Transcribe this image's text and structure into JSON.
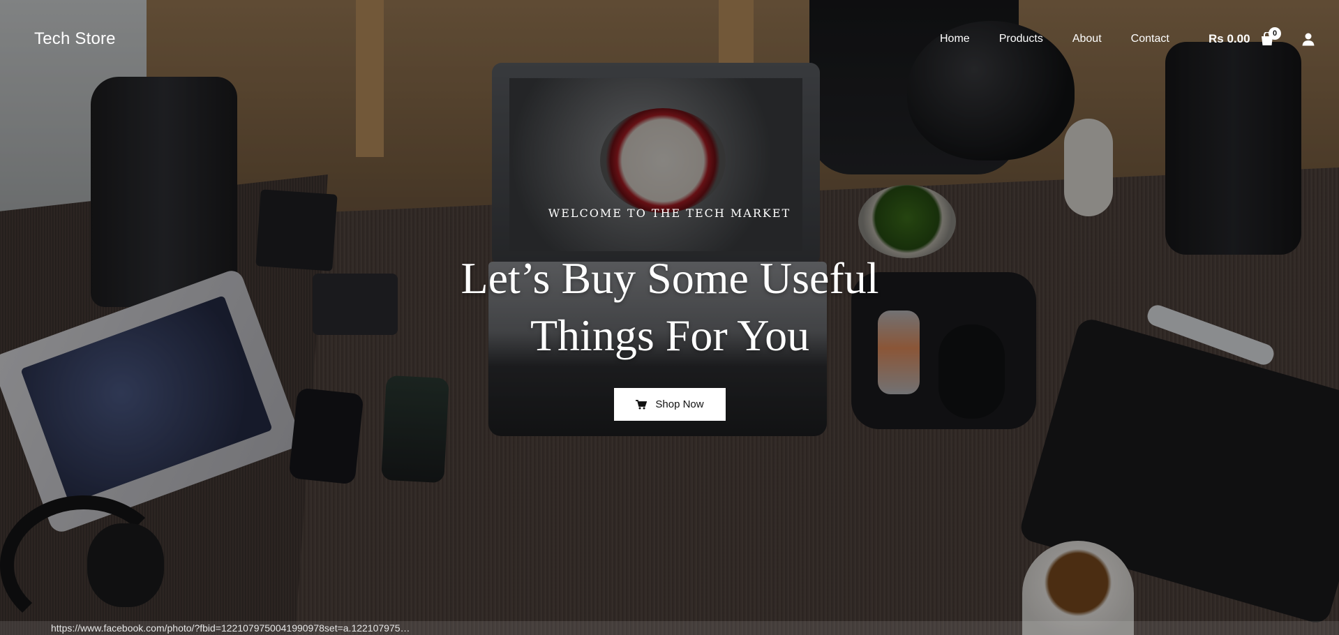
{
  "header": {
    "brand": "Tech Store",
    "nav": [
      "Home",
      "Products",
      "About",
      "Contact"
    ],
    "cart_total": "Rs 0.00",
    "cart_count": "0",
    "icons": {
      "cart": "shopping-bag-icon",
      "account": "user-icon"
    }
  },
  "hero": {
    "subtitle": "WELCOME TO THE TECH MARKET",
    "title_line1": "Let’s Buy Some Useful",
    "title_line2": "Things For You",
    "cta_label": "Shop Now",
    "cta_icon": "cart-icon"
  },
  "status_bar": {
    "url": "https://www.facebook.com/photo/?fbid=1221079750041990978set=a.122107975…"
  },
  "colors": {
    "text": "#ffffff",
    "button_bg": "#ffffff",
    "button_text": "#111111"
  }
}
